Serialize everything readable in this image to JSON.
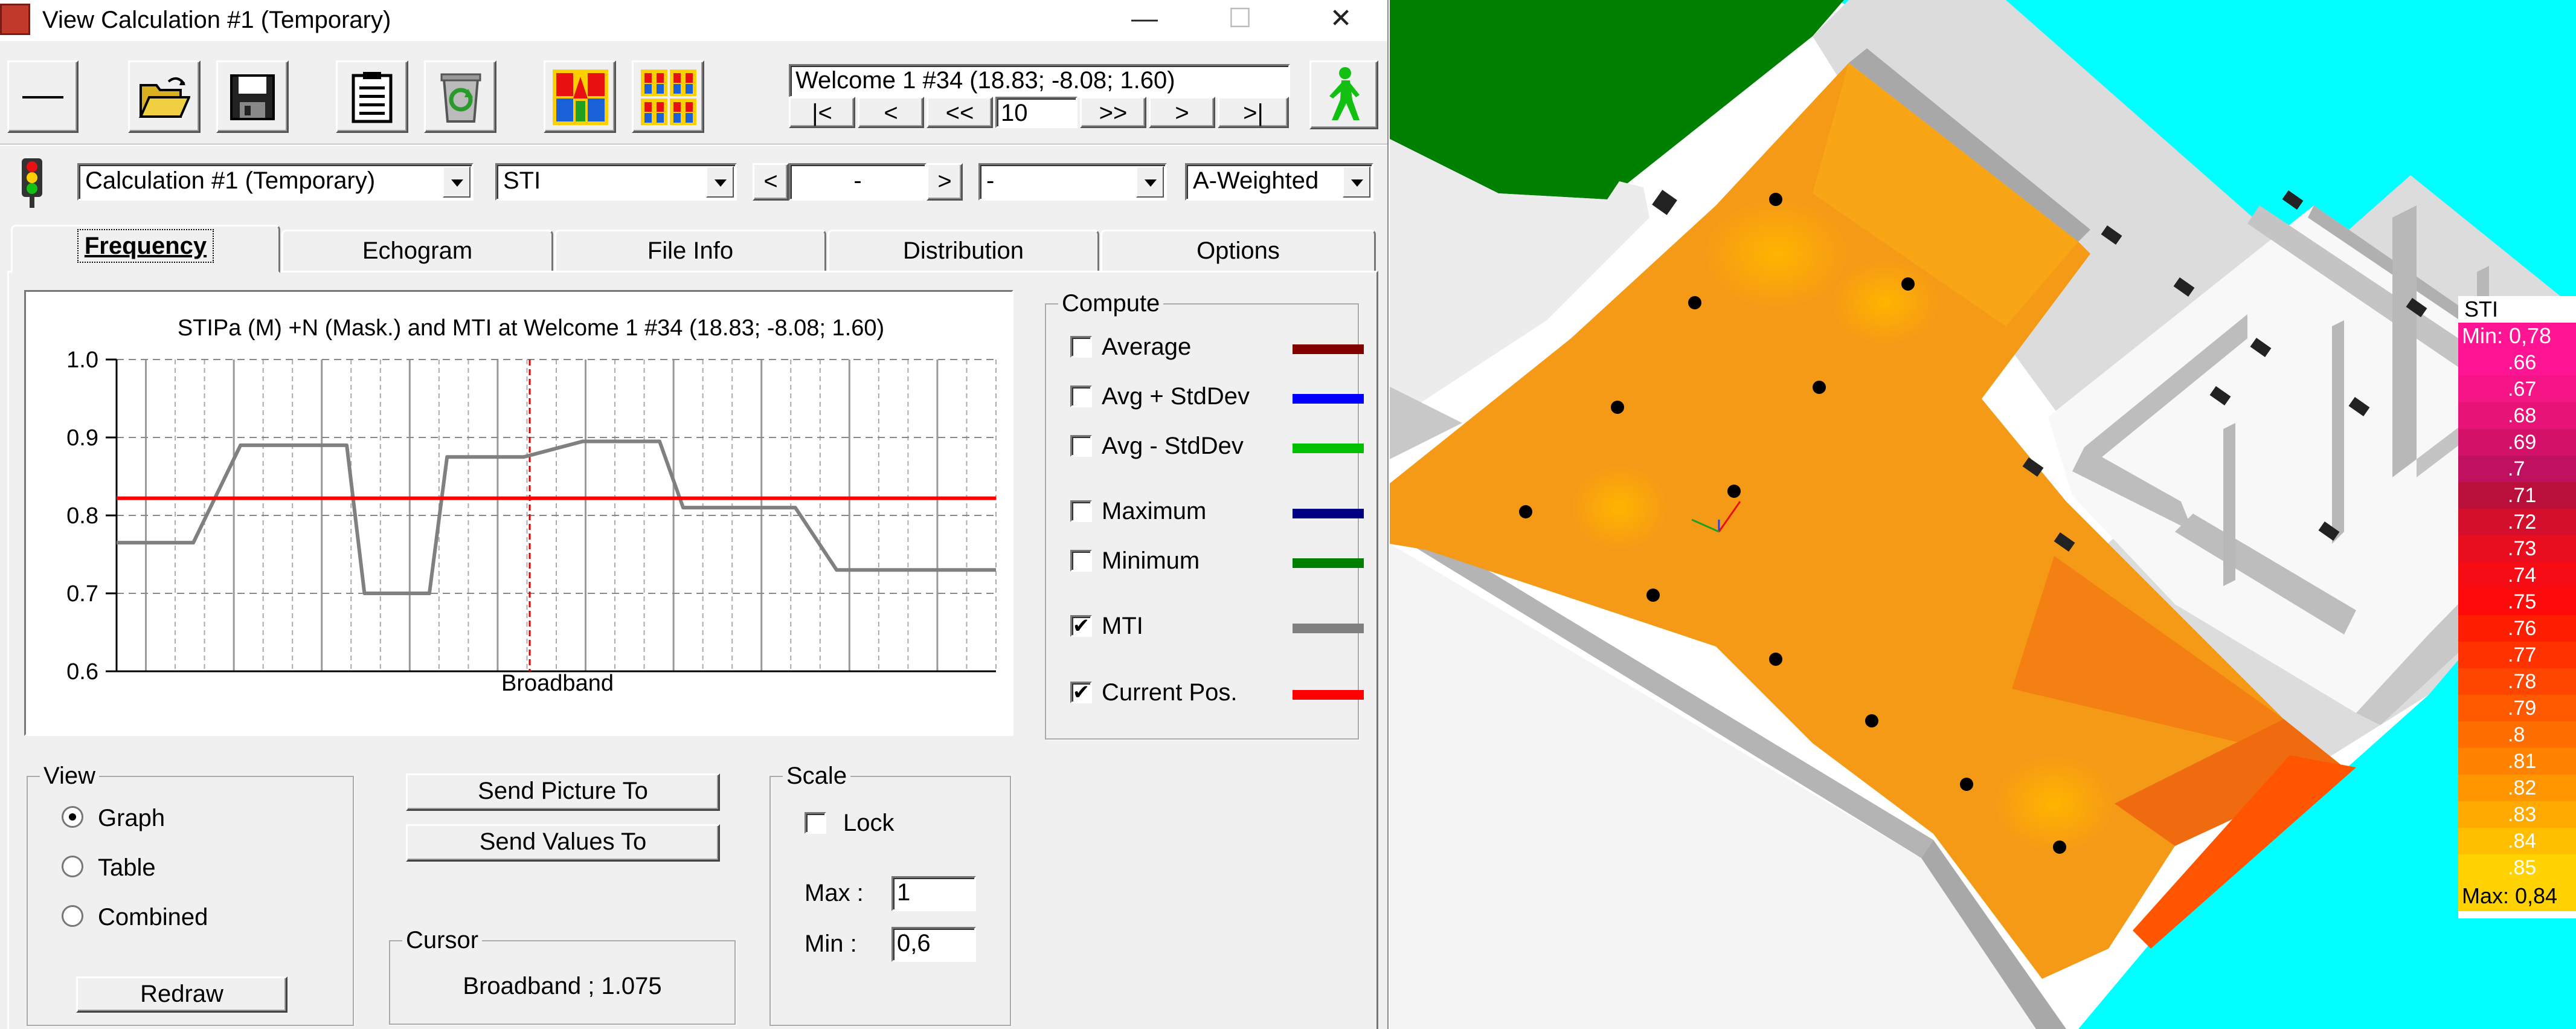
{
  "window": {
    "title": "View Calculation #1 (Temporary)",
    "controls": [
      "—",
      "☐",
      "✕"
    ]
  },
  "toolbar": {
    "location": "Welcome 1 #34  (18.83; -8.08; 1.60)",
    "nav": [
      "|<",
      "<",
      "<<",
      ">>",
      ">",
      ">|"
    ],
    "step_value": "10",
    "icons": [
      "minus-icon",
      "open-folder-icon",
      "save-disk-icon",
      "clipboard-icon",
      "recycle-icon",
      "color-grid-icon",
      "color-grid-multi-icon",
      "walking-man-icon"
    ]
  },
  "selectors": {
    "calculation": "Calculation #1 (Temporary)",
    "parameter": "STI",
    "band_prev": "<",
    "band_value": "-",
    "band_next": ">",
    "sub_value": "-",
    "weighting": "A-Weighted"
  },
  "tabs": [
    "Frequency",
    "Echogram",
    "File Info",
    "Distribution",
    "Options"
  ],
  "active_tab": "Frequency",
  "chart_data": {
    "type": "line",
    "title": "STIPa (M) +N (Mask.) and MTI at Welcome 1 #34  (18.83; -8.08; 1.60)",
    "xlabel": "Broadband",
    "ylabel": "",
    "ylim": [
      0.6,
      1.0
    ],
    "yticks": [
      "1.0",
      "0.9",
      "0.8",
      "0.7",
      "0.6"
    ],
    "grid": true,
    "x": [
      0,
      0.9,
      1.3,
      2.1,
      2.5,
      3.6,
      3.9,
      4.2,
      4.9,
      5.3,
      5.6,
      6.5,
      6.9,
      7.9,
      8.3,
      9.2,
      9.6,
      11.0,
      11.5,
      12.2,
      12.7,
      13.6,
      14.1,
      14.9
    ],
    "series": [
      {
        "name": "MTI",
        "color": "#808080",
        "values": [
          0.765,
          0.765,
          0.765,
          0.89,
          0.89,
          0.89,
          0.89,
          0.7,
          0.7,
          0.7,
          0.875,
          0.875,
          0.875,
          0.895,
          0.895,
          0.895,
          0.81,
          0.81,
          0.81,
          0.73,
          0.73,
          0.73,
          0.73,
          0.73
        ]
      },
      {
        "name": "Current Pos.",
        "color": "#ff0000",
        "constant": 0.822
      }
    ],
    "cursor_x": 7.0
  },
  "compute": {
    "title": "Compute",
    "items": [
      {
        "label": "Average",
        "checked": false,
        "color": "#800000"
      },
      {
        "label": "Avg + StdDev",
        "checked": false,
        "color": "#0000ff"
      },
      {
        "label": "Avg - StdDev",
        "checked": false,
        "color": "#00c000"
      },
      {
        "label": "Maximum",
        "checked": false,
        "color": "#000080"
      },
      {
        "label": "Minimum",
        "checked": false,
        "color": "#008000"
      },
      {
        "label": "MTI",
        "checked": true,
        "color": "#808080"
      },
      {
        "label": "Current Pos.",
        "checked": true,
        "color": "#ff0000"
      }
    ]
  },
  "view": {
    "title": "View",
    "options": [
      "Graph",
      "Table",
      "Combined"
    ],
    "selected": "Graph",
    "redraw": "Redraw"
  },
  "buttons": {
    "send_picture": "Send Picture To",
    "send_values": "Send Values To"
  },
  "cursor": {
    "title": "Cursor",
    "text": "Broadband ; 1.075"
  },
  "scale": {
    "title": "Scale",
    "lock_label": "Lock",
    "lock_checked": false,
    "max_label": "Max :",
    "max_value": "1",
    "min_label": "Min :",
    "min_value": "0,6"
  },
  "legend": {
    "title": "STI",
    "min_text": "Min:  0,78",
    "max_text": "Max:  0,84",
    "levels": [
      ".66",
      ".67",
      ".68",
      ".69",
      ".7",
      ".71",
      ".72",
      ".73",
      ".74",
      ".75",
      ".76",
      ".77",
      ".78",
      ".79",
      ".8",
      ".81",
      ".82",
      ".83",
      ".84",
      ".85"
    ],
    "colors": [
      "#ff1493",
      "#f51485",
      "#e81377",
      "#d41269",
      "#c01060",
      "#b8103a",
      "#d40f2c",
      "#e80e20",
      "#f50c14",
      "#ff0a0a",
      "#ff1e00",
      "#ff3200",
      "#ff4600",
      "#ff5a00",
      "#ff6e00",
      "#ff8200",
      "#ff9600",
      "#ffaa00",
      "#ffbe00",
      "#ffd200"
    ]
  }
}
